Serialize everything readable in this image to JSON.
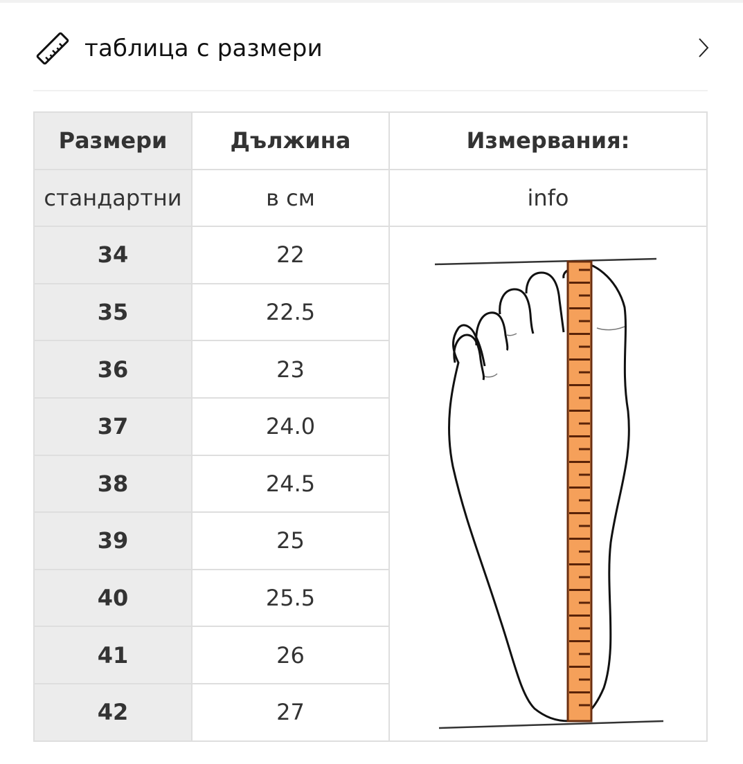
{
  "header": {
    "title": "таблица с размери",
    "icon": "ruler-icon",
    "chevron_icon": "chevron-right-icon"
  },
  "table": {
    "columns": [
      "Размери",
      "Дължина",
      "Измервания:"
    ],
    "subheaders": [
      "стандартни",
      "в см",
      "info"
    ],
    "rows": [
      {
        "size": "34",
        "length": "22"
      },
      {
        "size": "35",
        "length": "22.5"
      },
      {
        "size": "36",
        "length": "23"
      },
      {
        "size": "37",
        "length": "24.0"
      },
      {
        "size": "38",
        "length": "24.5"
      },
      {
        "size": "39",
        "length": "25"
      },
      {
        "size": "40",
        "length": "25.5"
      },
      {
        "size": "41",
        "length": "26"
      },
      {
        "size": "42",
        "length": "27"
      }
    ],
    "illustration": "foot-measurement-illustration"
  },
  "colors": {
    "tape": "#f5a05a",
    "tape_border": "#6b2f10",
    "first_column_bg": "#ececec",
    "border": "#dedede"
  }
}
